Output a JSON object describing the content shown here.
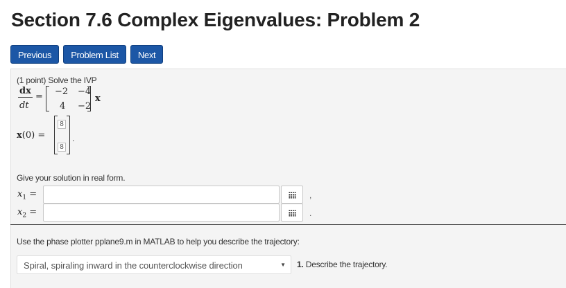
{
  "header": {
    "title": "Section 7.6 Complex Eigenvalues: Problem 2"
  },
  "nav": {
    "previous": "Previous",
    "problem_list": "Problem List",
    "next": "Next"
  },
  "problem": {
    "intro": "(1 point) Solve the IVP",
    "ode": {
      "numerator": "dx",
      "denominator": "dt",
      "equals": "=",
      "matrix": [
        [
          "−2",
          "−4"
        ],
        [
          "4",
          "−2"
        ]
      ],
      "vector": "x"
    },
    "initial": {
      "label": "x(0) =",
      "values": [
        "8",
        "8"
      ],
      "trail": "."
    },
    "give_text": "Give your solution in real form.",
    "answers": [
      {
        "var": "x",
        "sub": "1",
        "equals": "=",
        "value": "",
        "trail": ","
      },
      {
        "var": "x",
        "sub": "2",
        "equals": "=",
        "value": "",
        "trail": "."
      }
    ],
    "hint": "Use the phase plotter pplane9.m in MATLAB to help you describe the trajectory:",
    "trajectory": {
      "selected": "Spiral, spiraling inward in the counterclockwise direction",
      "question_num": "1.",
      "question_text": "Describe the trajectory."
    }
  }
}
